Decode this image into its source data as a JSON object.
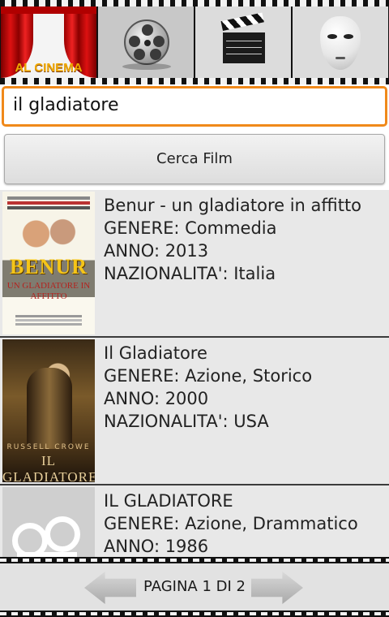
{
  "tabs": [
    {
      "label": "AL CINEMA",
      "icon": "cinema-curtain-icon"
    },
    {
      "label": "",
      "icon": "film-reel-icon"
    },
    {
      "label": "",
      "icon": "clapperboard-icon"
    },
    {
      "label": "",
      "icon": "theater-mask-icon"
    }
  ],
  "search": {
    "value": "il gladiatore"
  },
  "search_button": {
    "label": "Cerca Film"
  },
  "results": [
    {
      "title": "Benur - un gladiatore in affitto",
      "genre": "GENERE: Commedia",
      "year": "ANNO: 2013",
      "nationality": "NAZIONALITA': Italia",
      "poster": {
        "title_line1": "BENUR",
        "title_line2": "UN GLADIATORE IN AFFITTO"
      }
    },
    {
      "title": "Il Gladiatore",
      "genre": "GENERE: Azione, Storico",
      "year": "ANNO: 2000",
      "nationality": "NAZIONALITA': USA",
      "poster": {
        "title_line1": "RUSSELL CROWE",
        "title_line2": "IL GLADIATORE"
      }
    },
    {
      "title": "IL GLADIATORE",
      "genre": "GENERE: Azione, Drammatico",
      "year": "ANNO: 1986",
      "nationality": "",
      "poster": {
        "title_line1": "",
        "title_line2": ""
      }
    }
  ],
  "pagination": {
    "label": "PAGINA 1 DI 2"
  },
  "colors": {
    "search_border": "#f0891a",
    "accent_gold": "#f0a800",
    "list_bg": "#e8e8e8"
  }
}
